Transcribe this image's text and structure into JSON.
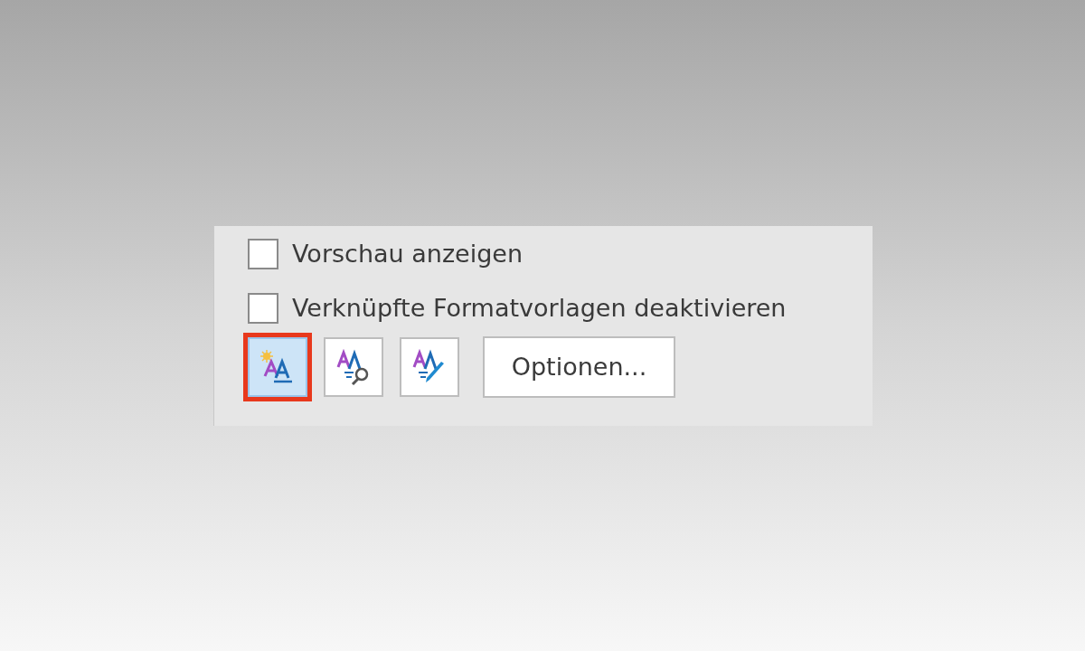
{
  "options": [
    {
      "label": "Vorschau anzeigen",
      "checked": false
    },
    {
      "label": "Verknüpfte Formatvorlagen deaktivieren",
      "checked": false
    }
  ],
  "toolbar": [
    {
      "kind": "new-style",
      "selected": true,
      "highlighted": true
    },
    {
      "kind": "inspector",
      "selected": false,
      "highlighted": false
    },
    {
      "kind": "manage",
      "selected": false,
      "highlighted": false
    }
  ],
  "options_button": "Optionen..."
}
